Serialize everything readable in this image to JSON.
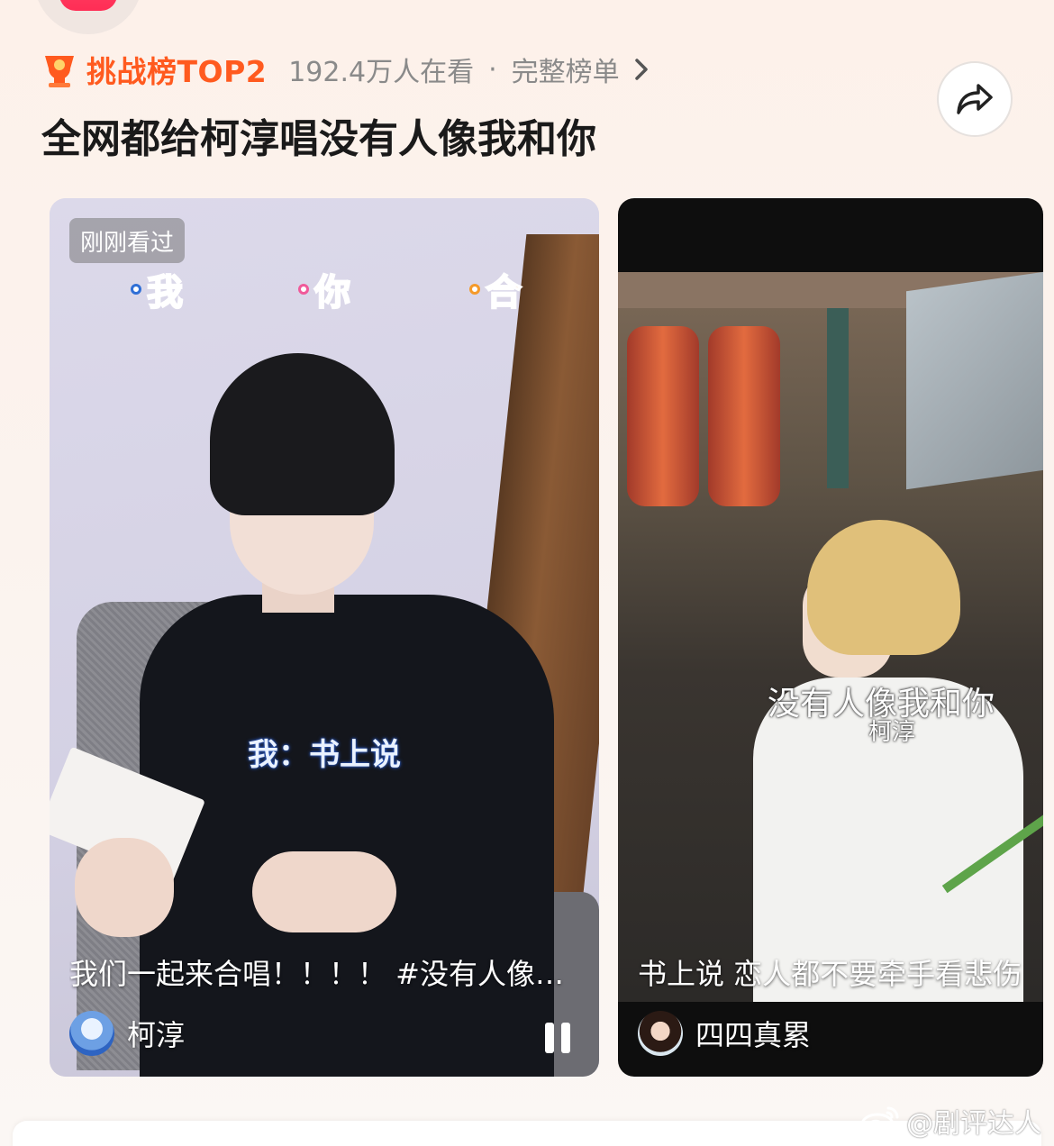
{
  "header": {
    "rank_label": "挑战榜TOP2",
    "watchers": "192.4万人在看",
    "separator": "·",
    "full_list": "完整榜单",
    "title": "全网都给柯淳唱没有人像我和你",
    "accent_color": "#ff5a1f",
    "icons": {
      "rank": "trophy-icon",
      "more": "chevron-right-icon",
      "share": "share-icon"
    }
  },
  "cards": [
    {
      "badge": "刚刚看过",
      "lyric_words": [
        "我",
        "你",
        "合"
      ],
      "center_subtitle": "我：书上说",
      "caption": "我们一起来合唱！！！！ #没有人像我…",
      "author": "柯淳",
      "control": "pause-icon"
    },
    {
      "overlay_title": "没有人像我和你",
      "overlay_subtitle": "柯淳",
      "caption": "书上说 恋人都不要牵手看悲伤",
      "author": "四四真累"
    }
  ],
  "watermark": {
    "icon": "weibo-icon",
    "text": "@剧评达人"
  }
}
